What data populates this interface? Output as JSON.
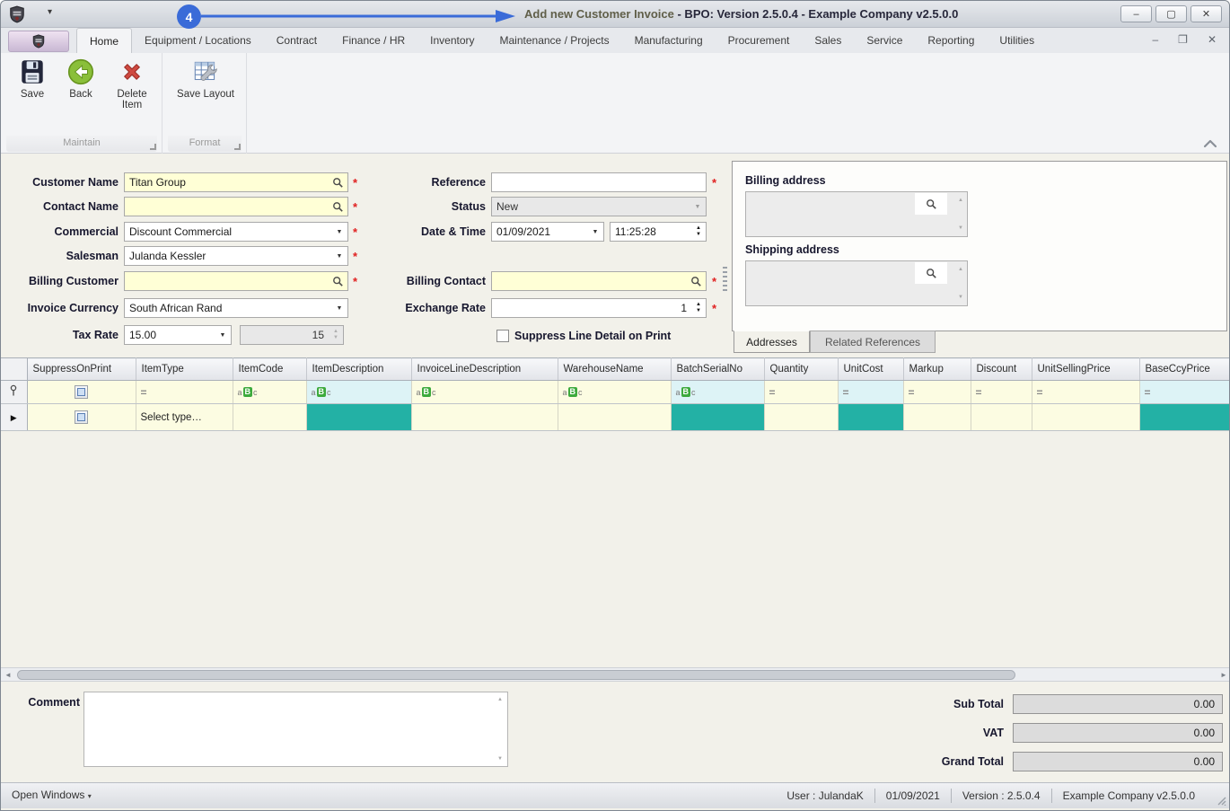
{
  "colors": {
    "accent_blue": "#3a6bd8",
    "teal_cell": "#23b1a5",
    "cyan_filter": "#ddf3f6",
    "yellow_field": "#ffffd6",
    "required_red": "#e02020",
    "back_green": "#8abf3a",
    "delete_red": "#cf4a41"
  },
  "icons": {
    "dropdown": "▼",
    "spin_up": "▲",
    "spin_down": "▼",
    "scroll_left": "◄",
    "scroll_right": "►",
    "minimize": "–",
    "maximize": "▢",
    "close": "✕",
    "restore": "❐",
    "row_arrow": "▶",
    "equals": "=",
    "abc_a": "a",
    "abc_b": "B",
    "abc_c": "c",
    "titlebar_caret": "▾",
    "open_windows_caret": "▾"
  },
  "titlebar": {
    "annotation": "4",
    "title_highlight": "Add new Customer Invoice",
    "title_rest": " - BPO: Version 2.5.0.4 - Example Company v2.5.0.0"
  },
  "ribbon": {
    "tabs": [
      {
        "label": "Home",
        "active": true
      },
      {
        "label": "Equipment / Locations"
      },
      {
        "label": "Contract"
      },
      {
        "label": "Finance / HR"
      },
      {
        "label": "Inventory"
      },
      {
        "label": "Maintenance / Projects"
      },
      {
        "label": "Manufacturing"
      },
      {
        "label": "Procurement"
      },
      {
        "label": "Sales"
      },
      {
        "label": "Service"
      },
      {
        "label": "Reporting"
      },
      {
        "label": "Utilities"
      }
    ],
    "buttons": {
      "save": "Save",
      "back": "Back",
      "delete_item": "Delete Item",
      "save_layout": "Save Layout"
    },
    "groups": {
      "maintain": "Maintain",
      "format": "Format"
    }
  },
  "form": {
    "required_marker": "*",
    "customer_name": {
      "label": "Customer Name",
      "value": "Titan Group"
    },
    "contact_name": {
      "label": "Contact Name",
      "value": ""
    },
    "commercial": {
      "label": "Commercial",
      "value": "Discount Commercial"
    },
    "salesman": {
      "label": "Salesman",
      "value": "Julanda Kessler"
    },
    "billing_customer": {
      "label": "Billing Customer",
      "value": ""
    },
    "invoice_currency": {
      "label": "Invoice Currency",
      "value": "South African Rand"
    },
    "tax_rate": {
      "label": "Tax Rate",
      "value": "15.00",
      "spin_value": "15"
    },
    "reference": {
      "label": "Reference",
      "value": ""
    },
    "status": {
      "label": "Status",
      "value": "New"
    },
    "date_time": {
      "label": "Date & Time",
      "date": "01/09/2021",
      "time": "11:25:28"
    },
    "billing_contact": {
      "label": "Billing Contact",
      "value": ""
    },
    "exchange_rate": {
      "label": "Exchange Rate",
      "value": "1"
    },
    "suppress_line_detail": {
      "label": "Suppress Line Detail on Print",
      "checked": false
    }
  },
  "addresses": {
    "billing_label": "Billing address",
    "shipping_label": "Shipping address",
    "tabs": [
      {
        "label": "Addresses",
        "active": true
      },
      {
        "label": "Related References"
      }
    ]
  },
  "grid": {
    "columns": [
      "SuppressOnPrint",
      "ItemType",
      "ItemCode",
      "ItemDescription",
      "InvoiceLineDescription",
      "WarehouseName",
      "BatchSerialNo",
      "Quantity",
      "UnitCost",
      "Markup",
      "Discount",
      "UnitSellingPrice",
      "BaseCcyPrice"
    ],
    "new_row": {
      "item_type_placeholder": "Select type…"
    }
  },
  "comment": {
    "label": "Comment"
  },
  "totals": {
    "sub_total": {
      "label": "Sub Total",
      "value": "0.00"
    },
    "vat": {
      "label": "VAT",
      "value": "0.00"
    },
    "grand_total": {
      "label": "Grand Total",
      "value": "0.00"
    }
  },
  "statusbar": {
    "open_windows": "Open Windows",
    "user": "User : JulandaK",
    "date": "01/09/2021",
    "version": "Version : 2.5.0.4",
    "company": "Example Company v2.5.0.0"
  }
}
